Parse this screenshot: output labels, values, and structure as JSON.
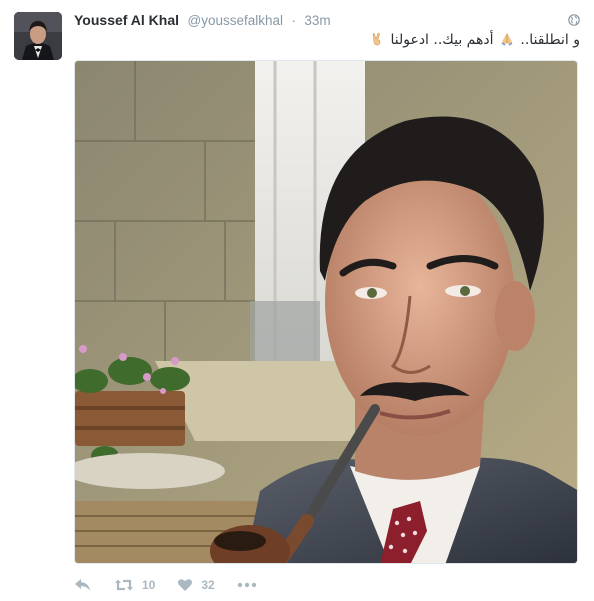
{
  "tweet": {
    "author_name": "Youssef Al Khal",
    "handle": "@youssefalkhal",
    "separator": "·",
    "time": "33m",
    "text_part1": "و انطلقنا..",
    "text_part2": "أدهم بيك.. ادعولنا",
    "text_emoji_1": "pray-hands-emoji",
    "text_emoji_2": "victory-hand-emoji"
  },
  "media": {
    "description_icon": "photo"
  },
  "actions": {
    "reply_icon": "reply-icon",
    "retweet_icon": "retweet-icon",
    "retweet_count": "10",
    "like_icon": "heart-icon",
    "like_count": "32",
    "more_icon": "more-dots-icon"
  },
  "colors": {
    "text": "#292f33",
    "muted": "#8899a6",
    "action": "#aab8c2"
  }
}
